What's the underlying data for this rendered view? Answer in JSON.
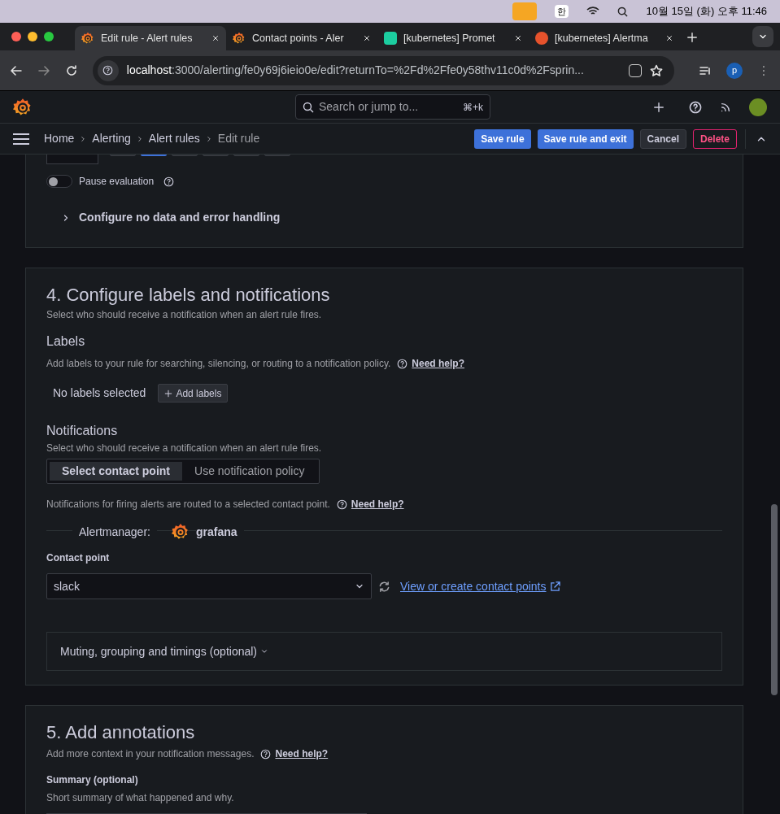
{
  "menu_bar": {
    "clock": "10월 15일 (화) 오후 11:46",
    "ime": "한"
  },
  "tabs": [
    {
      "title": "Edit rule - Alert rules",
      "kind": "grafana",
      "selected": true
    },
    {
      "title": "Contact points - Aler",
      "kind": "grafana",
      "selected": false
    },
    {
      "title": "[kubernetes] Promet",
      "kind": "tile",
      "selected": false
    },
    {
      "title": "[kubernetes] Alertma",
      "kind": "dot",
      "selected": false
    }
  ],
  "address_bar": {
    "url_host": "localhost",
    "url_rest": ":3000/alerting/fe0y69j6ieio0e/edit?returnTo=%2Fd%2Ffe0y58thv11c0d%2Fsprin...",
    "profile": "p"
  },
  "top_bar": {
    "search_placeholder": "Search or jump to...",
    "shortcut": "⌘+k"
  },
  "breadcrumbs": [
    {
      "label": "Home",
      "current": false
    },
    {
      "label": "Alerting",
      "current": false
    },
    {
      "label": "Alert rules",
      "current": false
    },
    {
      "label": "Edit rule",
      "current": true
    }
  ],
  "actions": [
    {
      "label": "Save rule",
      "kind": "primary"
    },
    {
      "label": "Save rule and exit",
      "kind": "primary"
    },
    {
      "label": "Cancel",
      "kind": "secondary"
    },
    {
      "label": "Delete",
      "kind": "danger"
    }
  ],
  "evaluation": {
    "interval_chips": [
      {
        "selected": false
      },
      {
        "selected": true
      },
      {
        "selected": false
      },
      {
        "selected": false
      },
      {
        "selected": false
      },
      {
        "selected": false
      }
    ],
    "pause": {
      "label": "Pause evaluation",
      "on": false
    },
    "no_data_section": "Configure no data and error handling"
  },
  "section4": {
    "title": "4. Configure labels and notifications",
    "subtitle": "Select who should receive a notification when an alert rule fires.",
    "labels": {
      "heading": "Labels",
      "description": "Add labels to your rule for searching, silencing, or routing to a notification policy.",
      "help": "Need help?",
      "empty": "No labels selected",
      "add_button": "Add labels"
    },
    "notifications": {
      "heading": "Notifications",
      "description": "Select who should receive a notification when an alert rule fires.",
      "modes": [
        {
          "label": "Select contact point",
          "selected": true
        },
        {
          "label": "Use notification policy",
          "selected": false
        }
      ],
      "routing_note": "Notifications for firing alerts are routed to a selected contact point.",
      "help": "Need help?",
      "alertmanager_label": "Alertmanager:",
      "alertmanager": "grafana",
      "contact_point_label": "Contact point",
      "contact_point": "slack",
      "link": "View or create contact points",
      "muting": "Muting, grouping and timings (optional)"
    }
  },
  "section5": {
    "title": "5. Add annotations",
    "subtitle": "Add more context in your notification messages.",
    "help": "Need help?",
    "summary_label": "Summary (optional)",
    "summary_hint": "Short summary of what happened and why."
  }
}
